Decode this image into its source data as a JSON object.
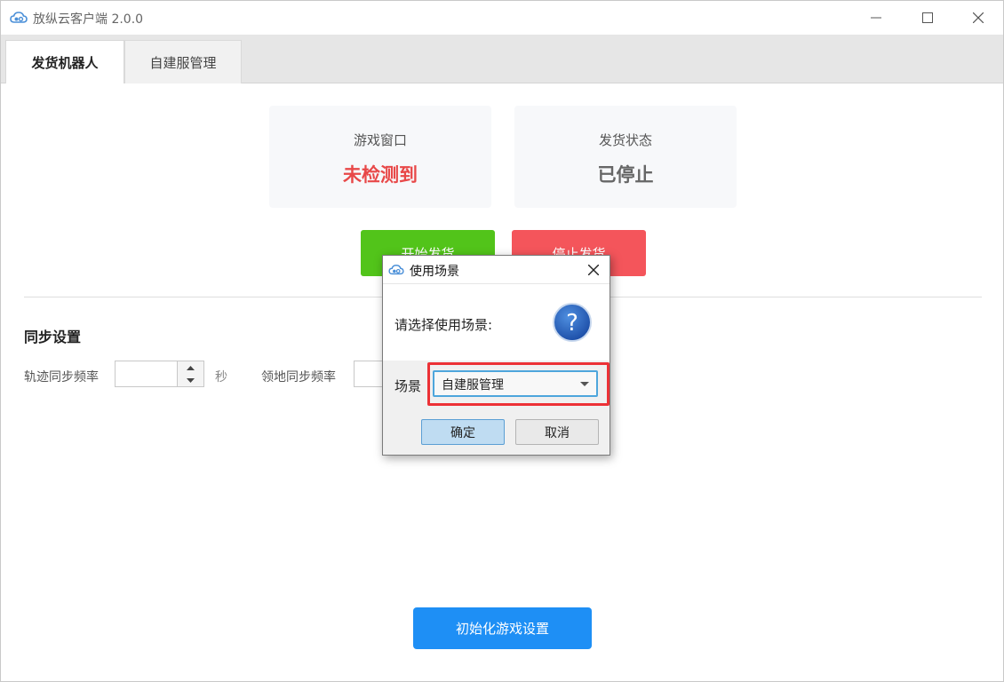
{
  "window": {
    "title": "放纵云客户端 2.0.0",
    "controls": {
      "minimize": "minimize",
      "maximize": "maximize",
      "close": "close"
    }
  },
  "tabs": [
    {
      "label": "发货机器人",
      "active": true
    },
    {
      "label": "自建服管理",
      "active": false
    }
  ],
  "status": {
    "game_window": {
      "label": "游戏窗口",
      "value": "未检测到",
      "color": "#e84848"
    },
    "delivery_status": {
      "label": "发货状态",
      "value": "已停止",
      "color": "#666666"
    }
  },
  "actions": {
    "start": "开始发货",
    "stop": "停止发货",
    "start_color": "#52c41a",
    "stop_color": "#f4555b"
  },
  "sync": {
    "title": "同步设置",
    "track_label": "轨迹同步频率",
    "track_value": "",
    "track_unit": "秒",
    "territory_label": "领地同步频率",
    "territory_value": ""
  },
  "init_button": "初始化游戏设置",
  "dialog": {
    "title": "使用场景",
    "prompt": "请选择使用场景:",
    "icon": "question-icon",
    "scene_label": "场景",
    "scene_value": "自建服管理",
    "ok": "确定",
    "cancel": "取消"
  },
  "colors": {
    "accent": "#1e8ff5",
    "highlight": "#ec3136"
  }
}
